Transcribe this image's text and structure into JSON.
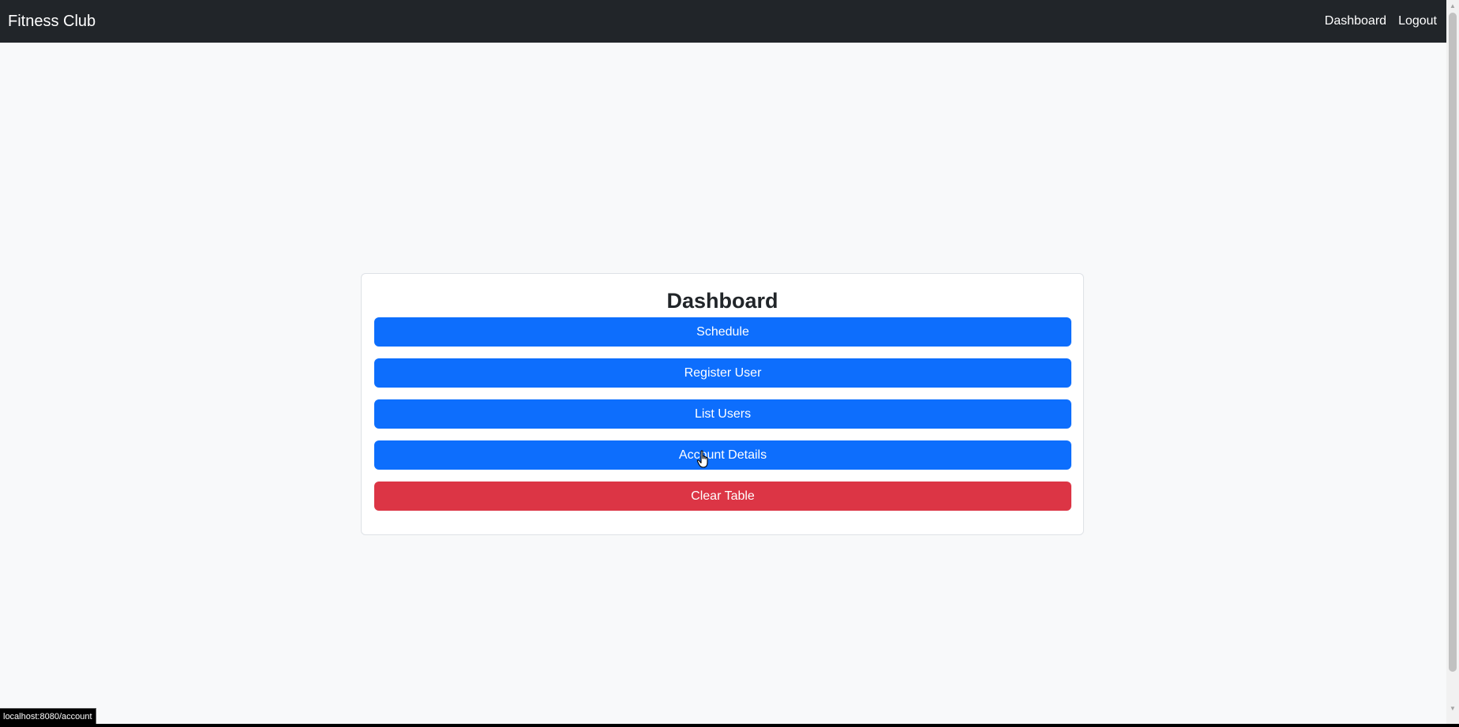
{
  "navbar": {
    "brand": "Fitness Club",
    "links": [
      "Dashboard",
      "Logout"
    ]
  },
  "card": {
    "title": "Dashboard",
    "buttons": [
      "Schedule",
      "Register User",
      "List Users",
      "Account Details",
      "Clear Table"
    ]
  },
  "status_bar": {
    "url": "localhost:8080/account"
  },
  "colors": {
    "navbar_bg": "#212529",
    "primary": "#0d6efd",
    "danger": "#dc3545",
    "page_bg": "#f8f9fa"
  },
  "icons": {
    "cursor": "hand-pointer-icon",
    "scroll_up": "scroll-up-arrow-icon",
    "scroll_down": "scroll-down-arrow-icon"
  }
}
